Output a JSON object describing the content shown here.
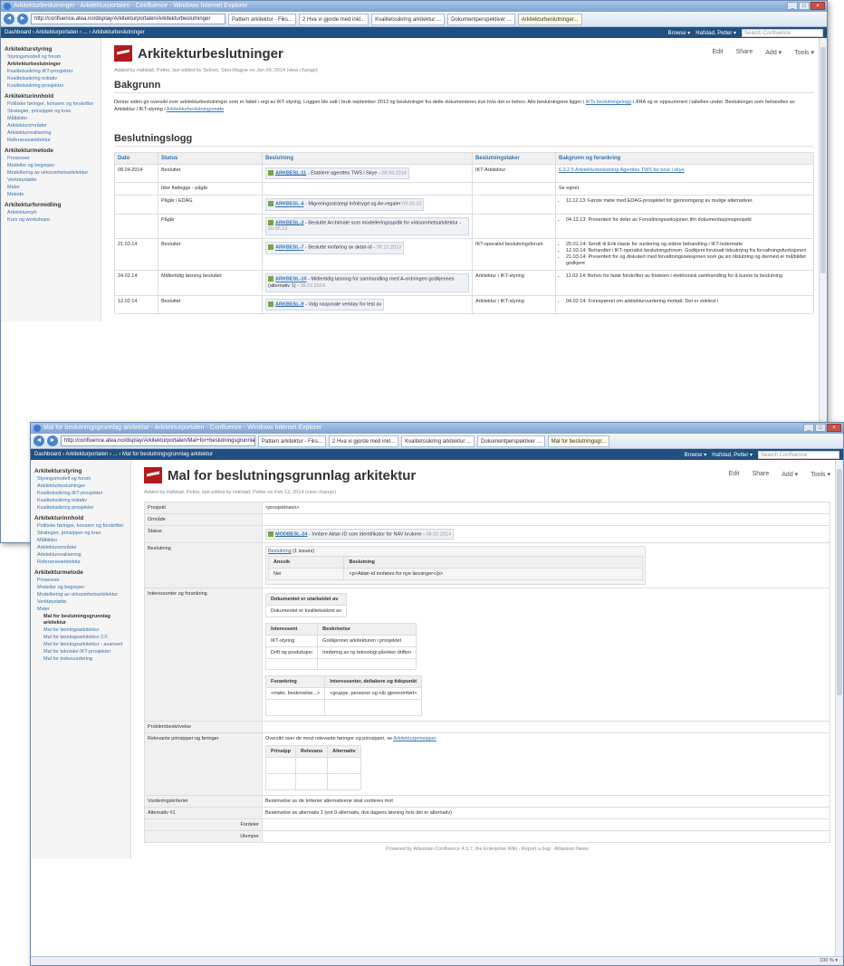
{
  "w1": {
    "title": "Arkitekturbeslutninger - Arkitekturportalen - Confluence - Windows Internet Explorer",
    "url": "http://confluence.atea.no/display/Arkitekturportalen/Arkitekturbeslutninger",
    "tabs": [
      "Pattern arkitektur - Fiks...",
      "2 Hva vi gjorde med inkl...",
      "Kvalitetssikring arkitektur ...",
      "Dokumentperspektiver ...",
      "Arkitekturbeslutninger..."
    ],
    "crumb": "Dashboard › Arkitekturportalen › ... › Arkitekturbeslutninger",
    "browse": "Browse ▾",
    "user": "Hafstad, Petter ▾",
    "search": "Search Confluence",
    "title_page": "Arkitekturbeslutninger",
    "actions": [
      "Edit",
      "Share",
      "Add ▾",
      "Tools ▾"
    ],
    "meta": "Added by Hafstad, Petter, last edited by Seltvet, Sten-Magne on Jan 09, 2014 (view change)",
    "h_bak": "Bakgrunn",
    "intro_a": "Denne siden gir oversikt over arkitekturbeslutninger som er fattet i regi av IKT-styring. Loggen ble satt i bruk september 2013 og beslutninger fra dette dokumenteres kun hvis det er behov. Alle beslutningene ligger i",
    "intro_link1": "IKTs beslutningslogg",
    "intro_b": "i JIRA og er oppsummert i tabellen under. Beslutninger som behandles av Arkitektur i IKT-styring i",
    "intro_link2": "Arkitekturbeslutningsmøte",
    "h_log": "Beslutningslogg",
    "cols": [
      "Dato",
      "Status",
      "Beslutning",
      "Beslutningstaker",
      "Bakgrunn og forankring"
    ],
    "rows": [
      {
        "date": "08.04.2014",
        "status": "Besluttet",
        "key": "ARKBESL-11",
        "sum": "Etablere agenttes TWS i Skye -",
        "stamp": "08.04.2014",
        "taker": "IKT-Arkitektur",
        "bak": [
          "6.3.2.5 Arkitekturbeslutning Agenttes TWS for bruk i skye"
        ]
      },
      {
        "date": "",
        "status": "Ikke flatlegge - pågår",
        "key": "",
        "sum": "",
        "stamp": "",
        "taker": "",
        "bak": [
          "Se egnet"
        ]
      },
      {
        "date": "",
        "status": "Pågår i EDAG",
        "key": "ARKBESL-4",
        "sum": "Migreringsstrategi Infolnygd og Ae-regaler",
        "stamp": "09.09.13",
        "taker": "",
        "bak": [
          "11.12.13: Første møte med EDAG-prosjektet for gjennomgang av mulige alternativer."
        ]
      },
      {
        "date": "",
        "status": "Pågår",
        "key": "ARKBESL-3",
        "sum": "Beslutte Archimate som modelleringsspråk for virksomhetsarkitektur -",
        "stamp": "20.05.13",
        "taker": "",
        "bak": [
          "04.12.13: Presentert for deler av Forvaltningsseksjonen ifm dokumentasjonsprosjekt"
        ]
      },
      {
        "date": "21.03.14",
        "status": "Besluttet",
        "key": "ARKBESL-7",
        "sum": "Beslutte innføring av aktør-id -",
        "stamp": "08.10.2013",
        "taker": "IKT-operativt beslutningsforum",
        "bak": [
          "25.01.14: Sendt til Erik Hasle for vurdering og videre behandling i IKT-ledermøte",
          "12.03.14: Behandlet i IKT-operativt beslutningsforum. Godkjent forutsatt tidsutnyng fra forvaltningsfunksjonen",
          "21.03.14: Presentert for og diskutert med forvaltningsseksjonen som ga sin tilslutning og dermed er målbildet godkjent"
        ]
      },
      {
        "date": "24.02.14",
        "status": "Midlertidig løsning besluttet",
        "key": "ARKBESL-10",
        "sum": "Midlertidig løsning for samhandling med A-ordningen godkjennes (alternativ 1) -",
        "stamp": "08.02.2014",
        "taker": "Arkitektur i IKT-styring",
        "bak": [
          "11.02.14: Behov for faste forskrifter av fristeten i elektronisk samhandling for å kunne ta beslutning"
        ]
      },
      {
        "date": "12.02.14",
        "status": "Besluttet",
        "key": "ARKBESL-9",
        "sum": "Valg nasjonale verktøy for test av",
        "stamp": "",
        "taker": "Arkitektur i IKT-styring",
        "bak": [
          "04.02.14: Forespørsel om arkitekturvurdering mottatt. Det er enklest i"
        ]
      }
    ],
    "sidebar": [
      {
        "h": "Arkitekturstyring",
        "items": [
          "Styringsmodell og forum",
          "Arkitekturbeslutninger",
          "Kvalitetssikring IKT-prosjekter",
          "Kvalitetssikring initiativ",
          "Kvalitetssikring prosjekter"
        ],
        "cur": 1
      },
      {
        "h": "Arkitekturinnhold",
        "items": [
          "Politiske føringer, konsern og forskrifter",
          "Strategier, prinsipper og krav",
          "Målbilder",
          "Arkitekturområder",
          "Arkitekturrealisering",
          "Referansearkitektur"
        ],
        "cur": -1
      },
      {
        "h": "Arkitekturmetode",
        "items": [
          "Prosesser",
          "Modeller og begreper",
          "Modellering av virksomhetsarkitektur",
          "Verktøystøtte",
          "Maler",
          "Metode"
        ],
        "cur": -1
      },
      {
        "h": "Arkitekturformidling",
        "items": [
          "Arkitekturnytt",
          "Kurs og workshops"
        ],
        "cur": -1
      }
    ],
    "status": ""
  },
  "w2": {
    "title": "Mal for beslutningsgrunnlag arkitektur - Arkitekturportalen - Confluence - Windows Internet Explorer",
    "url": "http://confluence.atea.no/display/Arkitekturportalen/Mal+for+beslutningsgrunnlag",
    "tabs": [
      "Pattern arkitektur - Fiks...",
      "2 Hva vi gjorde med inkl...",
      "Kvalitetssikring arkitektur ...",
      "Dokumentperspektiver ...",
      "Mal for beslutningsgr..."
    ],
    "crumb": "Dashboard › Arkitekturportalen › ... › Mal for beslutningsgrunnlag arkitektur",
    "browse": "Browse ▾",
    "user": "Hafstad, Petter ▾",
    "search": "Search Confluence",
    "title_page": "Mal for beslutningsgrunnlag arkitektur",
    "actions": [
      "Edit",
      "Share",
      "Add ▾",
      "Tools ▾"
    ],
    "meta": "Added by Hafstad, Petter, last edited by Hafstad, Petter on Feb 13, 2014 (view change)",
    "f_prosjekt": "Prosjekt",
    "v_prosjekt": "<prosjektnavn>",
    "f_omrade": "Område",
    "f_status": "Status",
    "v_status_key": "MODBESL-24",
    "v_status_sum": "Innføre Aktør-ID som identifikator for NAV brukere -",
    "v_status_stamp": "08.02.2014",
    "f_besl": "Beslutning",
    "v_besl_link": "Beslutning",
    "v_besl_count": "(1 issues)",
    "besl_cols": [
      "Ansvik",
      "Beslutning"
    ],
    "besl_row": [
      "Nei",
      "<p>Aktør-id innføres for nye løsninger</p>"
    ],
    "f_inter": "Interessenter og forankring",
    "dok_h": "Dokumentet er utarbeidet av",
    "dok_v": "Dokumentet er kvalitetssikret av",
    "int_cols": [
      "Interessent",
      "Beskrivelse"
    ],
    "int_rows": [
      [
        "IKT-styring",
        "Godkjenner arkitekturen i prosjektet"
      ],
      [
        "Drift og produksjon",
        "Innføring av ny teknologi påvirker driften"
      ]
    ],
    "for_cols": [
      "Forankring",
      "Interessenter, deltakere og tidspunkt"
    ],
    "for_row": [
      "<møte, beskrivelse...>",
      "<gruppe, personer og når gjennomført>"
    ],
    "f_problem": "Problembeskrivelse",
    "f_prins": "Relevante prinsipper og føringer",
    "v_prins": "Oversikt over de mest relevante føringer og prinsipper, se",
    "v_prins_link": "Arkitekturprinsipper",
    "prins_cols": [
      "Prinsipp",
      "Relevans",
      "Alternativ"
    ],
    "f_vurd": "Vurderingskriterier",
    "v_vurd": "Beskrivelse av de kriterier alternativene skal vurderes mot",
    "f_alt": "Alternativ #1",
    "v_alt": "Beskrivelse av alternativ 1 (evt 0-alternativ, dvs dagens løsning hvis det er alternativ)",
    "f_fordeler": "Fordeler",
    "f_ulemper": "Ulemper",
    "sidebar": [
      {
        "h": "Arkitekturstyring",
        "items": [
          "Styringsmodell og forum",
          "Arkitekturbeslutninger",
          "Kvalitetssikring IKT-prosjekter",
          "Kvalitetssikring initiativ",
          "Kvalitetssikring prosjekter"
        ]
      },
      {
        "h": "Arkitekturinnhold",
        "items": [
          "Politiske føringer, konsern og forskrifter",
          "Strategier, prinsipper og krav",
          "Målbilder",
          "Arkitekturområder",
          "Arkitekturrealisering",
          "Referansearkitektur"
        ]
      },
      {
        "h": "Arkitekturmetode",
        "items": [
          "Prosesser",
          "Modeller og begreper",
          "Modellering av virksomhetsarkitektur",
          "Verktøystøtte",
          "Maler"
        ]
      }
    ],
    "maler_sub": [
      "Mal for beslutningsgrunnlag arkitektur",
      "Mal for løsningsarkitektur",
      "Mal for løsningsarkitektur 2.0",
      "Mal for løsningsarkitektur - avansert",
      "Mal for tekniske IKT-prosjekter",
      "Mal for risikovurdering"
    ],
    "footer": "Powered by Atlassian Confluence 4.3.7, the Enterprise Wiki · Report a bug · Atlassian News",
    "zoom": "100 % ▾"
  }
}
